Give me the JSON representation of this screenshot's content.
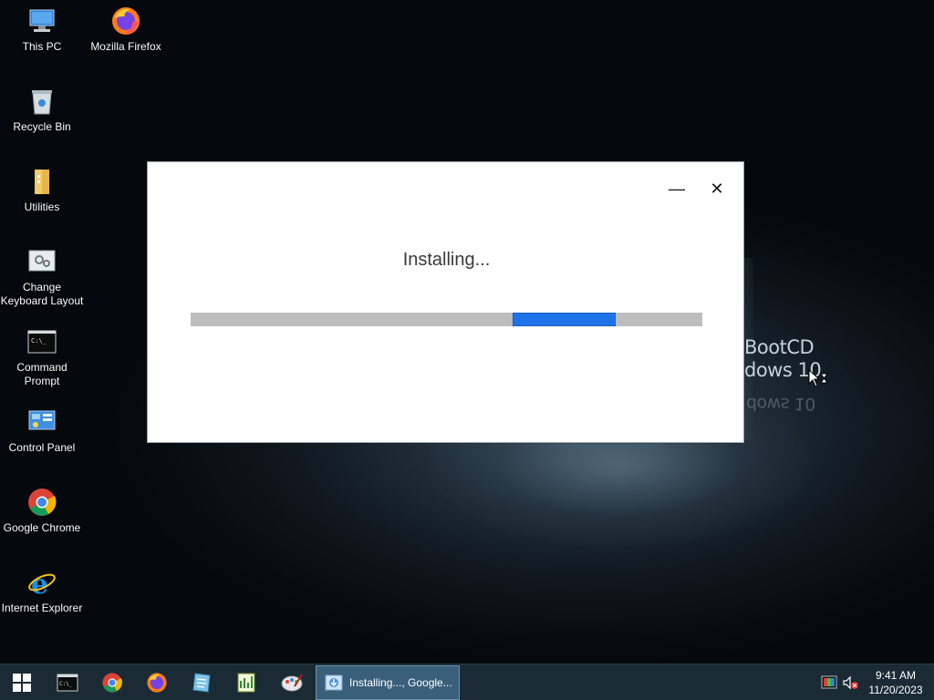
{
  "desktop": {
    "icons": [
      {
        "label": "This PC",
        "icon": "computer-icon"
      },
      {
        "label": "Mozilla Firefox",
        "icon": "firefox-icon"
      },
      {
        "label": "Recycle Bin",
        "icon": "recycle-bin-icon"
      },
      {
        "label": "Utilities",
        "icon": "folder-icon"
      },
      {
        "label": "Change Keyboard Layout",
        "icon": "keyboard-settings-icon"
      },
      {
        "label": "Command Prompt",
        "icon": "cmd-icon"
      },
      {
        "label": "Control Panel",
        "icon": "control-panel-icon"
      },
      {
        "label": "Google Chrome",
        "icon": "chrome-icon"
      },
      {
        "label": "Internet Explorer",
        "icon": "ie-icon"
      }
    ],
    "wallpaper_text": {
      "line1": "BootCD",
      "line2": "dows 10",
      "reflection": "dows 10"
    }
  },
  "dialog": {
    "title": "Installing...",
    "minimize_glyph": "—",
    "close_glyph": "✕",
    "progress": {
      "start": 0.63,
      "fraction": 0.2
    },
    "accent": "#1e73e8"
  },
  "taskbar": {
    "start_icon": "windows-start-icon",
    "pinned": [
      "cmd-icon",
      "chrome-icon",
      "firefox-icon",
      "notepad-icon",
      "chart-app-icon",
      "paint-app-icon"
    ],
    "active_window": {
      "label": "Installing..., Google...",
      "icon": "installer-icon"
    },
    "tray": {
      "icons": [
        "color-icon",
        "volume-muted-icon"
      ]
    },
    "clock": {
      "time": "9:41 AM",
      "date": "11/20/2023"
    }
  }
}
